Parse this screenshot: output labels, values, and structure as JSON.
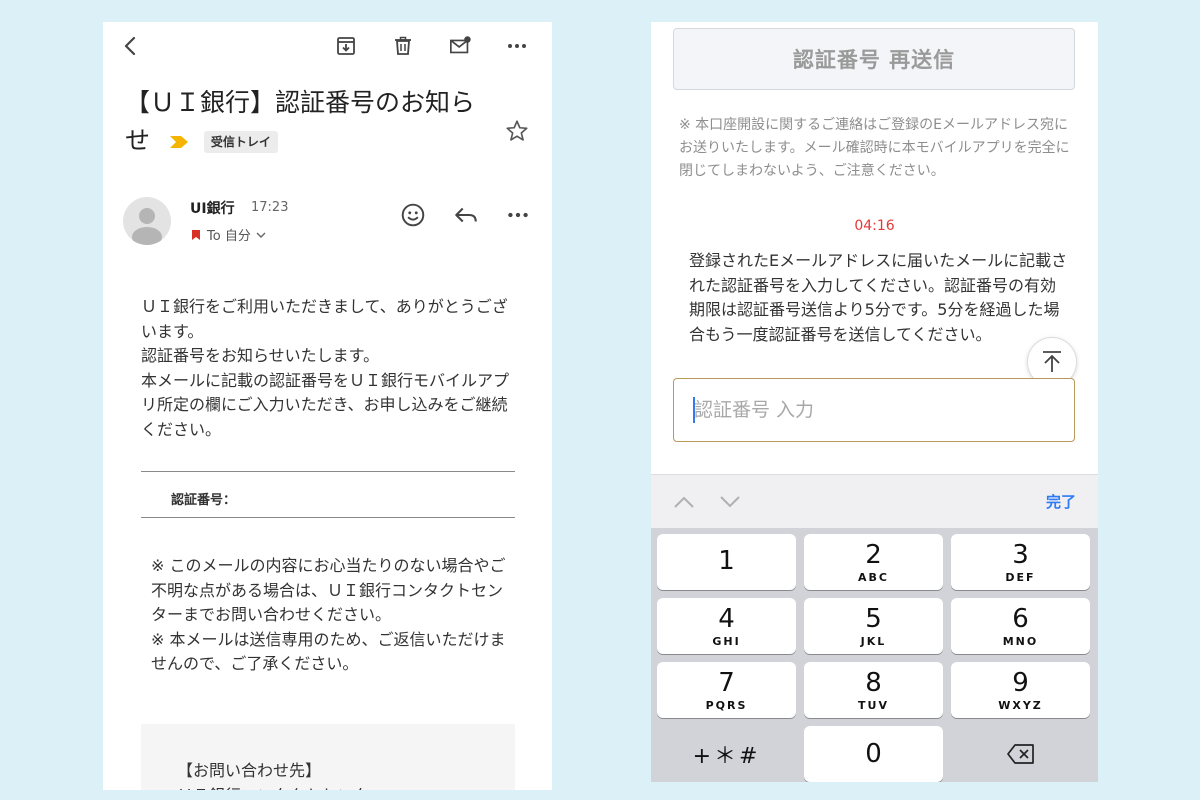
{
  "email": {
    "toolbar": {
      "back_icon": "chevron-left-icon",
      "archive_icon": "archive-icon",
      "delete_icon": "trash-icon",
      "mark_unread_icon": "mail-dot-icon",
      "more_icon": "more-horiz-icon"
    },
    "subject": "【ＵＩ銀行】認証番号のお知らせ",
    "label": "受信トレイ",
    "sender": "UI銀行",
    "time": "17:23",
    "to": "To 自分",
    "body": [
      "ＵＩ銀行をご利用いただきまして、ありがとうございます。",
      "認証番号をお知らせいたします。",
      "本メールに記載の認証番号をＵＩ銀行モバイルアプリ所定の欄にご入力いただき、お申し込みをご継続ください。"
    ],
    "code_label": "認証番号：",
    "notes": [
      "※ このメールの内容にお心当たりのない場合やご不明な点がある場合は、ＵＩ銀行コンタクトセンターまでお問い合わせください。",
      "※ 本メールは送信専用のため、ご返信いただけませんので、ご了承ください。"
    ],
    "contact_title": "【お問い合わせ先】",
    "contact_partial": "ＵＩ銀行コンタクトセンター"
  },
  "verify": {
    "resend_button": "認証番号 再送信",
    "notice": "※ 本口座開設に関するご連絡はご登録のEメールアドレス宛にお送りいたします。メール確認時に本モバイルアプリを完全に閉じてしまわないよう、ご注意ください。",
    "timer": "04:16",
    "instructions": "登録されたEメールアドレスに届いたメールに記載された認証番号を入力してください。認証番号の有効期限は認証番号送信より5分です。5分を経過した場合もう一度認証番号を送信してください。",
    "input_placeholder": "認証番号 入力",
    "done": "完了"
  },
  "keypad": {
    "keys": [
      {
        "num": "1",
        "letters": ""
      },
      {
        "num": "2",
        "letters": "ABC"
      },
      {
        "num": "3",
        "letters": "DEF"
      },
      {
        "num": "4",
        "letters": "GHI"
      },
      {
        "num": "5",
        "letters": "JKL"
      },
      {
        "num": "6",
        "letters": "MNO"
      },
      {
        "num": "7",
        "letters": "PQRS"
      },
      {
        "num": "8",
        "letters": "TUV"
      },
      {
        "num": "9",
        "letters": "WXYZ"
      },
      {
        "num": "0",
        "letters": ""
      }
    ],
    "symbols": "+＊#"
  },
  "colors": {
    "page_bg": "#dcf0f7",
    "timer": "#e53935",
    "done": "#2f7bf6",
    "label_arrow": "#f4b400",
    "input_border": "#b89a5c"
  }
}
